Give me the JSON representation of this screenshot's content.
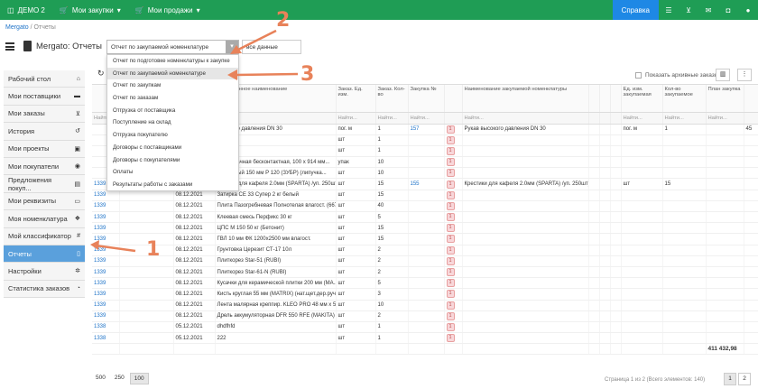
{
  "topbar": {
    "brand": "ДЕМО 2",
    "menu": [
      "Мои закупки",
      "Мои продажи"
    ],
    "help": "Справка",
    "icons": [
      "list-icon",
      "cart-icon",
      "envelope-icon",
      "chat-icon",
      "user-icon"
    ]
  },
  "breadcrumb": {
    "root": "Mergato",
    "sep": "/",
    "current": "Отчеты"
  },
  "page": {
    "title": "Mergato: Отчеты",
    "report_select": "Отчет по закупаемой номенклатуре",
    "data_select": "все данные"
  },
  "dropdown": {
    "options": [
      "Отчет по подготовке номенклатуры к закупке",
      "Отчет по закупаемой номенклатуре",
      "Отчет по закупкам",
      "Отчет по заказам",
      "Отгрузка от поставщика",
      "Поступление на склад",
      "Отгрузка покупателю",
      "Договоры с поставщиками",
      "Договоры с покупателями",
      "Оплаты",
      "Результаты работы с заказами"
    ],
    "highlighted_index": 1
  },
  "sidebar": {
    "items": [
      {
        "label": "Рабочий стол",
        "icon": "home-icon",
        "glyph": "⌂"
      },
      {
        "label": "Мои поставщики",
        "icon": "truck-icon",
        "glyph": "▬"
      },
      {
        "label": "Мои заказы",
        "icon": "cart-icon",
        "glyph": "⊻"
      },
      {
        "label": "История",
        "icon": "history-icon",
        "glyph": "↺"
      },
      {
        "label": "Мои проекты",
        "icon": "briefcase-icon",
        "glyph": "▣"
      },
      {
        "label": "Мои покупатели",
        "icon": "handshake-icon",
        "glyph": "◉"
      },
      {
        "label": "Предложения покуп...",
        "icon": "box-icon",
        "glyph": "▤"
      },
      {
        "label": "Мои реквизиты",
        "icon": "card-icon",
        "glyph": "▭"
      },
      {
        "label": "Моя номенклатура",
        "icon": "cubes-icon",
        "glyph": "❖"
      },
      {
        "label": "Мой классификатор",
        "icon": "hash-icon",
        "glyph": "#"
      },
      {
        "label": "Отчеты",
        "icon": "file-icon",
        "glyph": "▯"
      },
      {
        "label": "Настройки",
        "icon": "gears-icon",
        "glyph": "✲"
      },
      {
        "label": "Статистика заказов",
        "icon": "pie-chart-icon",
        "glyph": "◔"
      }
    ],
    "active_index": 10
  },
  "toolbar": {
    "archive_label": "Показать архивные заказы"
  },
  "table": {
    "headers": [
      "",
      "",
      "",
      "Запрошенное наименование",
      "Заказ. Ед. изм.",
      "Заказ. Кол-во",
      "Закупка №",
      "",
      "Наименование закупаемой номенклатуры",
      "",
      "",
      "",
      "Ед. изм. закупаемая",
      "Кол-во закупаемое",
      "План закупка",
      ""
    ],
    "filter": "Найти...",
    "rows": [
      [
        "",
        "",
        "",
        "высокого давления DN 30",
        "пог. м",
        "1",
        "157",
        "1",
        "Рукав высокого давления DN 30",
        "пог. м",
        "1",
        "",
        "45"
      ],
      [
        "",
        "",
        "",
        "",
        "шт",
        "1",
        "",
        "1",
        "",
        "",
        "",
        "",
        ""
      ],
      [
        "",
        "",
        "",
        "",
        "шт",
        "1",
        "",
        "1",
        "",
        "",
        "",
        "",
        ""
      ],
      [
        "",
        "",
        "",
        "ка наждачная бесконтактная, 100 х 914 мм...",
        "упак",
        "10",
        "",
        "1",
        "",
        "",
        "",
        "",
        ""
      ],
      [
        "",
        "",
        "",
        "бразивный 150 мм Р 120 (ЗУБР) (липучка...",
        "шт",
        "10",
        "",
        "1",
        "",
        "",
        "",
        "",
        ""
      ],
      [
        "1339",
        "",
        "08.12.2021",
        "рестики для кафеля 2.0мм (SPARTA) /уп. 250шт)",
        "шт",
        "15",
        "155",
        "1",
        "Крестики для кафеля 2.0мм (SPARTA) /уп. 250шт)",
        "шт",
        "15",
        "",
        ""
      ],
      [
        "1339",
        "",
        "08.12.2021",
        "Затирка CE 33 Супер 2 кг белый",
        "шт",
        "15",
        "",
        "1",
        "",
        "",
        "",
        "",
        ""
      ],
      [
        "1339",
        "",
        "08.12.2021",
        "Плита Пазогребневая Полнотелая влагост. (667...",
        "шт",
        "40",
        "",
        "1",
        "",
        "",
        "",
        "",
        ""
      ],
      [
        "1339",
        "",
        "08.12.2021",
        "Клеевая смесь Перфикс 30 кг",
        "шт",
        "5",
        "",
        "1",
        "",
        "",
        "",
        "",
        ""
      ],
      [
        "1339",
        "",
        "08.12.2021",
        "ЦПС М 150 50 кг (Бетонит)",
        "шт",
        "15",
        "",
        "1",
        "",
        "",
        "",
        "",
        ""
      ],
      [
        "1339",
        "",
        "08.12.2021",
        "ГВЛ 10 мм ФК 1200х2500 мм влагост.",
        "шт",
        "15",
        "",
        "1",
        "",
        "",
        "",
        "",
        ""
      ],
      [
        "1339",
        "",
        "08.12.2021",
        "Грунтовка Церезит СТ-17 10л",
        "шт",
        "2",
        "",
        "1",
        "",
        "",
        "",
        "",
        ""
      ],
      [
        "1339",
        "",
        "08.12.2021",
        "Плиткорез Star-51 (RUBI)",
        "шт",
        "2",
        "",
        "1",
        "",
        "",
        "",
        "",
        ""
      ],
      [
        "1339",
        "",
        "08.12.2021",
        "Плиткорез Star-61-N (RUBI)",
        "шт",
        "2",
        "",
        "1",
        "",
        "",
        "",
        "",
        ""
      ],
      [
        "1339",
        "",
        "08.12.2021",
        "Кусачки для керамической плитки 200 мм (МА...",
        "шт",
        "5",
        "",
        "1",
        "",
        "",
        "",
        "",
        ""
      ],
      [
        "1339",
        "",
        "08.12.2021",
        "Кисть круглая 55 мм (MATRIX) (нат.щет.дер.руч...",
        "шт",
        "3",
        "",
        "1",
        "",
        "",
        "",
        "",
        ""
      ],
      [
        "1339",
        "",
        "08.12.2021",
        "Лента малярная креппир. KLEO PRO 48 мм х 50...",
        "шт",
        "10",
        "",
        "1",
        "",
        "",
        "",
        "",
        ""
      ],
      [
        "1339",
        "",
        "08.12.2021",
        "Дрель аккумуляторная DFR 550 RFE (MAKITA) /...",
        "шт",
        "2",
        "",
        "1",
        "",
        "",
        "",
        "",
        ""
      ],
      [
        "1338",
        "",
        "05.12.2021",
        "dhdfhfd",
        "шт",
        "1",
        "",
        "1",
        "",
        "",
        "",
        "",
        ""
      ],
      [
        "1338",
        "",
        "05.12.2021",
        "222",
        "шт",
        "1",
        "",
        "1",
        "",
        "",
        "",
        "",
        ""
      ]
    ],
    "total": "411 432,98"
  },
  "pager": {
    "sizes": [
      "500",
      "250",
      "100"
    ],
    "active_size": "100",
    "info": "Страница 1 из 2 (Всего элементов: 140)",
    "pages": [
      "1",
      "2"
    ]
  },
  "annotations": {
    "n1": "1",
    "n2": "2",
    "n3": "3",
    "color": "#e8825a"
  }
}
